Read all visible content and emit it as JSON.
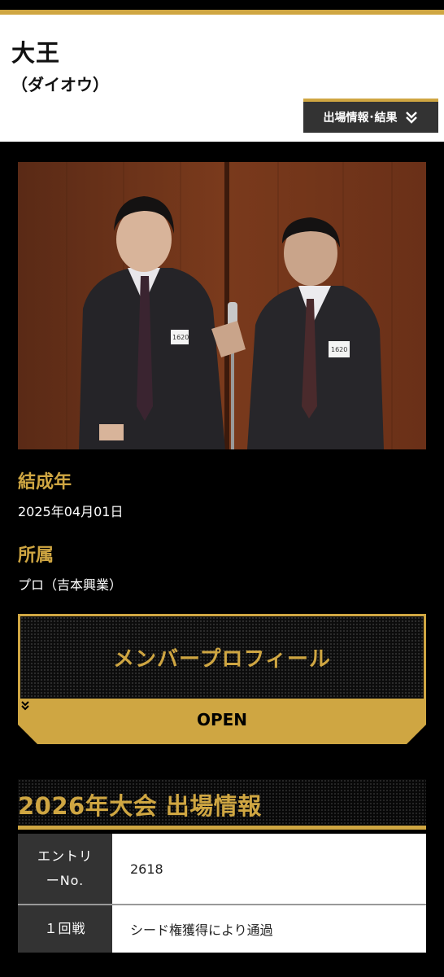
{
  "header": {
    "name": "大王",
    "kana": "（ダイオウ）",
    "result_button_label": "出場情報･結果"
  },
  "profile_info": {
    "formed_label": "結成年",
    "formed_value": "2025年04月01日",
    "affiliation_label": "所属",
    "affiliation_value": "プロ（吉本興業）"
  },
  "member_profile": {
    "title": "メンバープロフィール",
    "open_label": "OPEN"
  },
  "entry_section": {
    "title": "2026年大会 出場情報",
    "rows": [
      {
        "label": "エントリーNo.",
        "label_line1": "エントリ",
        "label_line2": "ーNo.",
        "value": "2618"
      },
      {
        "label": "１回戦",
        "value": "シード権獲得により通過"
      }
    ]
  },
  "photo": {
    "badge_left": "1620",
    "badge_right": "1620"
  },
  "colors": {
    "accent_gold": "#cfa642",
    "background": "#000000",
    "header_bg": "#ffffff",
    "table_label_bg": "#333333"
  },
  "icons": [
    "double-chevron-down-icon"
  ]
}
